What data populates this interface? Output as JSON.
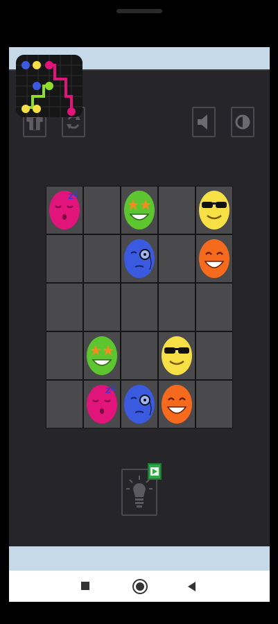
{
  "toolbar": {
    "home_icon": "shirt-icon",
    "restart_icon": "restart-icon",
    "sound_icon": "speaker-icon",
    "theme_icon": "contrast-icon"
  },
  "hint": {
    "icon": "lightbulb-icon",
    "badge_icon": "video-play-icon"
  },
  "board": {
    "rows": 5,
    "cols": 5,
    "pieces": [
      {
        "row": 0,
        "col": 0,
        "type": "sleeping",
        "color": "#e0147a"
      },
      {
        "row": 0,
        "col": 2,
        "type": "star-eyes",
        "color": "#5cc52f"
      },
      {
        "row": 0,
        "col": 4,
        "type": "sunglasses",
        "color": "#f7e046"
      },
      {
        "row": 1,
        "col": 2,
        "type": "monocle",
        "color": "#3a5ae0"
      },
      {
        "row": 1,
        "col": 4,
        "type": "grin",
        "color": "#f56a1d"
      },
      {
        "row": 3,
        "col": 1,
        "type": "star-eyes",
        "color": "#5cc52f"
      },
      {
        "row": 3,
        "col": 3,
        "type": "sunglasses",
        "color": "#f7e046"
      },
      {
        "row": 4,
        "col": 1,
        "type": "sleeping",
        "color": "#e0147a"
      },
      {
        "row": 4,
        "col": 2,
        "type": "monocle",
        "color": "#3a5ae0"
      },
      {
        "row": 4,
        "col": 3,
        "type": "grin",
        "color": "#f56a1d"
      }
    ]
  },
  "nav": {
    "recents_icon": "square-icon",
    "home_icon": "circle-icon",
    "back_icon": "triangle-back-icon"
  }
}
